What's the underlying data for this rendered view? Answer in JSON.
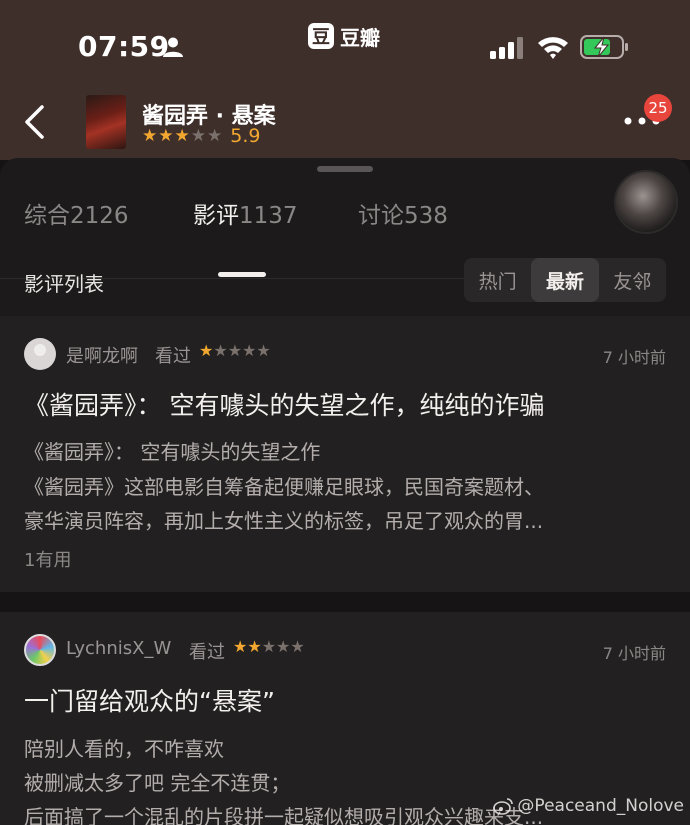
{
  "status_bar": {
    "time": "07:59",
    "app_logo": "豆",
    "app_name": "豆瓣"
  },
  "header": {
    "movie_title": "酱园弄 · 悬案",
    "rating": {
      "score": "5.9",
      "stars_filled": 3,
      "stars_total": 5
    },
    "notification_count": "25"
  },
  "tabs": [
    {
      "label": "综合",
      "count": "2126"
    },
    {
      "label": "影评",
      "count": "1137"
    },
    {
      "label": "讨论",
      "count": "538"
    }
  ],
  "active_tab": 1,
  "list": {
    "title": "影评列表",
    "sort_options": [
      "热门",
      "最新",
      "友邻"
    ],
    "active_sort": 1
  },
  "reviews": [
    {
      "username": "是啊龙啊",
      "status": "看过",
      "stars_filled": 1,
      "timestamp": "7 小时前",
      "title": "《酱园弄》： 空有噱头的失望之作，纯纯的诈骗",
      "lines": [
        "《酱园弄》： 空有噱头的失望之作",
        "《酱园弄》这部电影自筹备起便赚足眼球，民国奇案题材、",
        "豪华演员阵容，再加上女性主义的标签，吊足了观众的胃..."
      ],
      "helpful": "1有用"
    },
    {
      "username": "LychnisX_W",
      "status": "看过",
      "stars_filled": 2,
      "timestamp": "7 小时前",
      "title": "一门留给观众的“悬案”",
      "lines": [
        "陪别人看的，不咋喜欢",
        "被删减太多了吧 完全不连贯；",
        "后面搞了一个混乱的片段拼一起疑似想吸引观众兴趣来支..."
      ]
    }
  ],
  "watermark": "@Peaceand_Nolove",
  "colors": {
    "header_bg": "#3f2f2b",
    "star_on": "#f2a830",
    "badge": "#e8453c"
  }
}
